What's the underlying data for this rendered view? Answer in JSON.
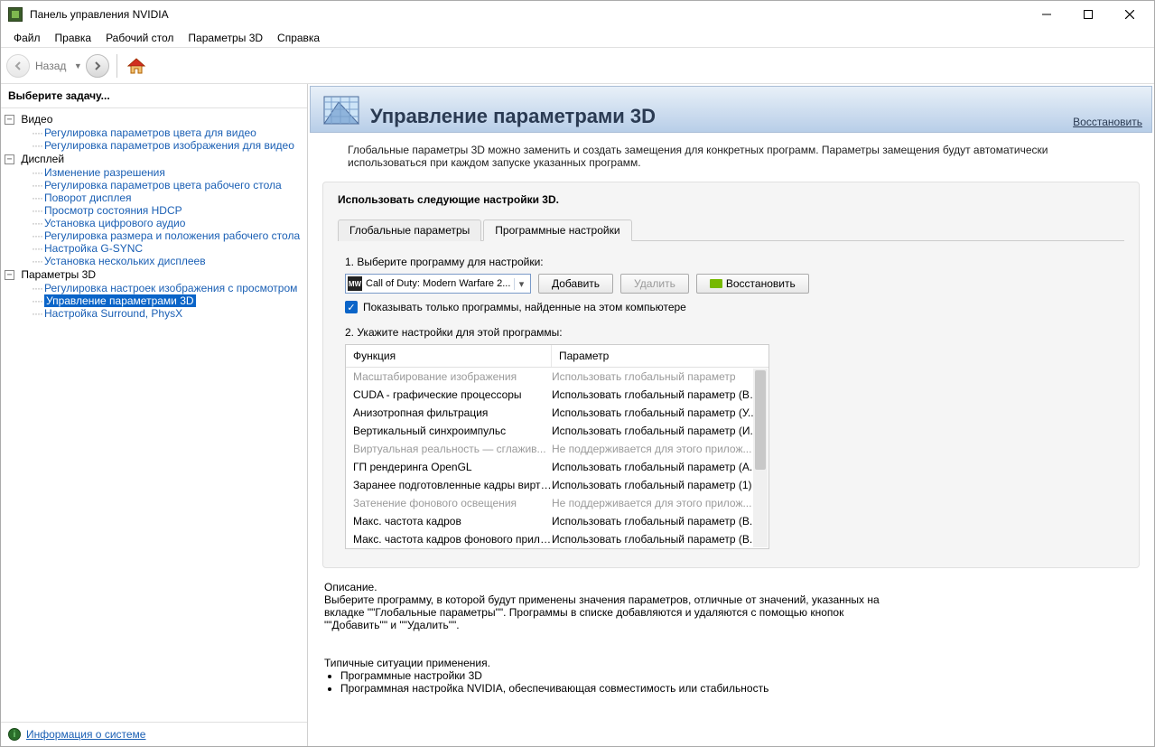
{
  "window": {
    "title": "Панель управления NVIDIA"
  },
  "menu": [
    "Файл",
    "Правка",
    "Рабочий стол",
    "Параметры 3D",
    "Справка"
  ],
  "toolbar": {
    "back_label": "Назад"
  },
  "sidebar": {
    "header": "Выберите задачу...",
    "groups": [
      {
        "label": "Видео",
        "items": [
          "Регулировка параметров цвета для видео",
          "Регулировка параметров изображения для видео"
        ]
      },
      {
        "label": "Дисплей",
        "items": [
          "Изменение разрешения",
          "Регулировка параметров цвета рабочего стола",
          "Поворот дисплея",
          "Просмотр состояния HDCP",
          "Установка цифрового аудио",
          "Регулировка размера и положения рабочего стола",
          "Настройка G-SYNC",
          "Установка нескольких дисплеев"
        ]
      },
      {
        "label": "Параметры 3D",
        "items": [
          "Регулировка настроек изображения с просмотром",
          "Управление параметрами 3D",
          "Настройка Surround, PhysX"
        ]
      }
    ],
    "selected": "Управление параметрами 3D",
    "sysinfo": "Информация о системе"
  },
  "page": {
    "title": "Управление параметрами 3D",
    "restore": "Восстановить",
    "intro": "Глобальные параметры 3D можно заменить и создать замещения для конкретных программ. Параметры замещения будут автоматически использоваться при каждом запуске указанных программ.",
    "panel_title": "Использовать следующие настройки 3D.",
    "tabs": {
      "global": "Глобальные параметры",
      "program": "Программные настройки"
    },
    "step1": "1. Выберите программу для настройки:",
    "program_selected": "Call of Duty: Modern Warfare 2...",
    "btn_add": "Добавить",
    "btn_remove": "Удалить",
    "btn_restore": "Восстановить",
    "check_label": "Показывать только программы, найденные на этом компьютере",
    "step2": "2. Укажите настройки для этой программы:",
    "col_function": "Функция",
    "col_param": "Параметр",
    "rows": [
      {
        "f": "Масштабирование изображения",
        "p": "Использовать глобальный параметр",
        "dim": true
      },
      {
        "f": "CUDA - графические процессоры",
        "p": "Использовать глобальный параметр (Все)"
      },
      {
        "f": "Анизотропная фильтрация",
        "p": "Использовать глобальный параметр (У..."
      },
      {
        "f": "Вертикальный синхроимпульс",
        "p": "Использовать глобальный параметр (И..."
      },
      {
        "f": "Виртуальная реальность — сглажив...",
        "p": "Не поддерживается для этого прилож...",
        "dim": true
      },
      {
        "f": "ГП рендеринга OpenGL",
        "p": "Использовать глобальный параметр (А..."
      },
      {
        "f": "Заранее подготовленные кадры вирту...",
        "p": "Использовать глобальный параметр (1)"
      },
      {
        "f": "Затенение фонового освещения",
        "p": "Не поддерживается для этого прилож...",
        "dim": true
      },
      {
        "f": "Макс. частота кадров",
        "p": "Использовать глобальный параметр (В..."
      },
      {
        "f": "Макс. частота кадров фонового прило...",
        "p": "Использовать глобальный параметр (В..."
      }
    ],
    "desc_title": "Описание.",
    "desc_body": "Выберите программу, в которой будут применены значения параметров, отличные от значений, указанных на вкладке \"\"Глобальные параметры\"\". Программы в списке добавляются и удаляются с помощью кнопок \"\"Добавить\"\" и \"\"Удалить\"\".",
    "usage_title": "Типичные ситуации применения.",
    "usage_items": [
      "Программные настройки 3D",
      "Программная настройка NVIDIA, обеспечивающая совместимость или стабильность"
    ]
  }
}
